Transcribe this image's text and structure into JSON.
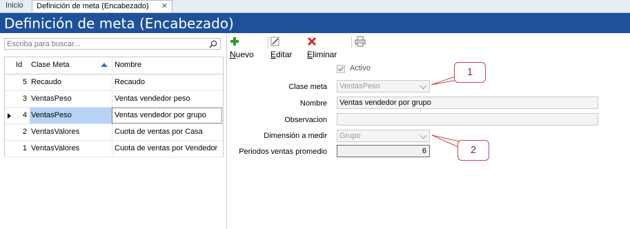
{
  "tabs": {
    "inicio": "Inicio",
    "active": "Definición de meta (Encabezado)",
    "close": "✕"
  },
  "title": "Definición de meta (Encabezado)",
  "search": {
    "placeholder": "Escriba para buscar..."
  },
  "grid": {
    "headers": {
      "id": "Id",
      "clase": "Clase Meta",
      "nombre": "Nombre"
    },
    "rows": [
      {
        "id": "5",
        "clase": "Recaudo",
        "nombre": "Recaudo"
      },
      {
        "id": "3",
        "clase": "VentasPeso",
        "nombre": "Ventas vendedor peso"
      },
      {
        "id": "4",
        "clase": "VentasPeso",
        "nombre": "Ventas vendedor por grupo"
      },
      {
        "id": "2",
        "clase": "VentasValores",
        "nombre": "Cuota de ventas por Casa"
      },
      {
        "id": "1",
        "clase": "VentasValores",
        "nombre": "Cuota de ventas por Vendedor"
      }
    ],
    "selected_row": 2
  },
  "toolbar": {
    "nuevo_u": "N",
    "nuevo_rest": "uevo",
    "editar_u": "E",
    "editar_rest": "ditar",
    "eliminar_u": "E",
    "eliminar_rest": "liminar"
  },
  "form": {
    "activo_label": "Activo",
    "activo_checked": true,
    "clase_label": "Clase meta",
    "clase_value": "VentasPeso",
    "nombre_label": "Nombre",
    "nombre_value": "Ventas vendedor por grupo",
    "observacion_label": "Observacion",
    "observacion_value": "",
    "dimension_label": "Dimensión a medir",
    "dimension_value": "Grupo",
    "periodos_label": "Periodos ventas promedio",
    "periodos_value": "6"
  },
  "callouts": {
    "one": "1",
    "two": "2"
  },
  "colors": {
    "titlebar": "#1d5199",
    "selection": "#b6d3f5",
    "callout_border": "#c9434b"
  }
}
